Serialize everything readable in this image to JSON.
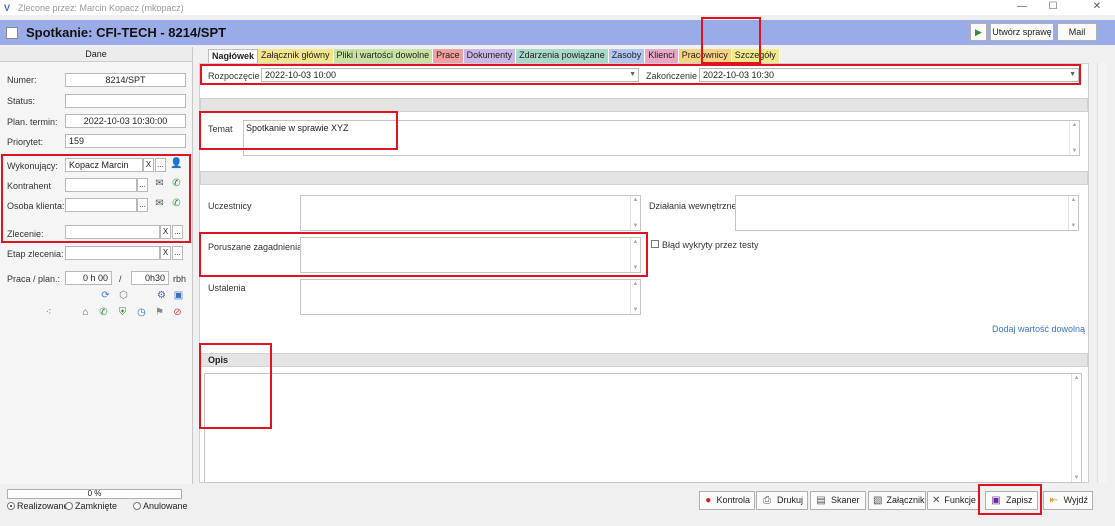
{
  "window": {
    "title": "Zlecone przez: Marcin Kopacz (mkopacz)",
    "controls": {
      "minimize": "—",
      "maximize": "☐",
      "close": "✕"
    }
  },
  "header": {
    "title": "Spotkanie: CFI-TECH - 8214/SPT",
    "play_symbol": "▶",
    "create_case_label": "Utwórz sprawę",
    "mail_label": "Mail"
  },
  "left_panel": {
    "heading": "Dane",
    "numer": {
      "label": "Numer:",
      "value": "8214/SPT"
    },
    "status": {
      "label": "Status:",
      "value": ""
    },
    "plan_termin": {
      "label": "Plan. termin:",
      "value": "2022-10-03 10:30:00"
    },
    "priorytet": {
      "label": "Priorytet:",
      "value": "159"
    },
    "wykonujacy": {
      "label": "Wykonujący:",
      "value": "Kopacz Marcin"
    },
    "kontrahent": {
      "label": "Kontrahent",
      "value": ""
    },
    "osoba_klienta": {
      "label": "Osoba klienta:",
      "value": ""
    },
    "zlecenie": {
      "label": "Zlecenie:",
      "value": ""
    },
    "etap_zlecenia": {
      "label": "Etap zlecenia:",
      "value": ""
    },
    "praca": {
      "label": "Praca / plan.:",
      "value": "0 h 00",
      "separator": "/",
      "plan_value": "0h30",
      "unit": "rbh"
    },
    "small": {
      "clear": "X",
      "more": "..."
    }
  },
  "tabs": [
    {
      "label": "Nagłówek",
      "color": "#ffffff"
    },
    {
      "label": "Załącznik główny",
      "color": "#f3e58c"
    },
    {
      "label": "Pliki i wartości dowolne",
      "color": "#c6e3a4"
    },
    {
      "label": "Prace",
      "color": "#f0a0a0"
    },
    {
      "label": "Dokumenty",
      "color": "#c9b8e6"
    },
    {
      "label": "Zdarzenia powiązane",
      "color": "#a8d9c8"
    },
    {
      "label": "Zasoby",
      "color": "#b0c6ee"
    },
    {
      "label": "Klienci",
      "color": "#e6a8c4"
    },
    {
      "label": "Pracownicy",
      "color": "#f6d283"
    },
    {
      "label": "Szczegóły",
      "color": "#f1e98a"
    }
  ],
  "form": {
    "rozpoczecie": {
      "label": "Rozpoczęcie",
      "value": "2022-10-03 10:00"
    },
    "zakonczenie": {
      "label": "Zakończenie",
      "value": "2022-10-03 10:30"
    },
    "temat": {
      "label": "Temat",
      "value": "Spotkanie w sprawie XYZ"
    },
    "uczestnicy": {
      "label": "Uczestnicy",
      "value": ""
    },
    "poruszane": {
      "label": "Poruszane zagadnienia",
      "value": ""
    },
    "ustalenia": {
      "label": "Ustalenia",
      "value": ""
    },
    "dzialania": {
      "label": "Działania wewnętrzne",
      "value": ""
    },
    "blad": {
      "label": "Błąd wykryty przez testy"
    },
    "add_value_link": "Dodaj wartość dowolną",
    "opis": {
      "label": "Opis",
      "value": ""
    }
  },
  "bottom": {
    "progress_text": "0 %",
    "progress_fraction": 0,
    "radios": [
      {
        "label": "Realizowane",
        "selected": true
      },
      {
        "label": "Zamknięte",
        "selected": false
      },
      {
        "label": "Anulowane",
        "selected": false
      }
    ],
    "buttons": {
      "kontrola": "Kontrola",
      "drukuj": "Drukuj",
      "skaner": "Skaner",
      "zalacznik": "Załącznik",
      "funkcje": "Funkcje",
      "zapisz": "Zapisz",
      "wyjdz": "Wyjdź"
    }
  },
  "colors": {
    "header_bg": "#9aace8",
    "highlight": "#e0141e",
    "link": "#3b74c9"
  }
}
